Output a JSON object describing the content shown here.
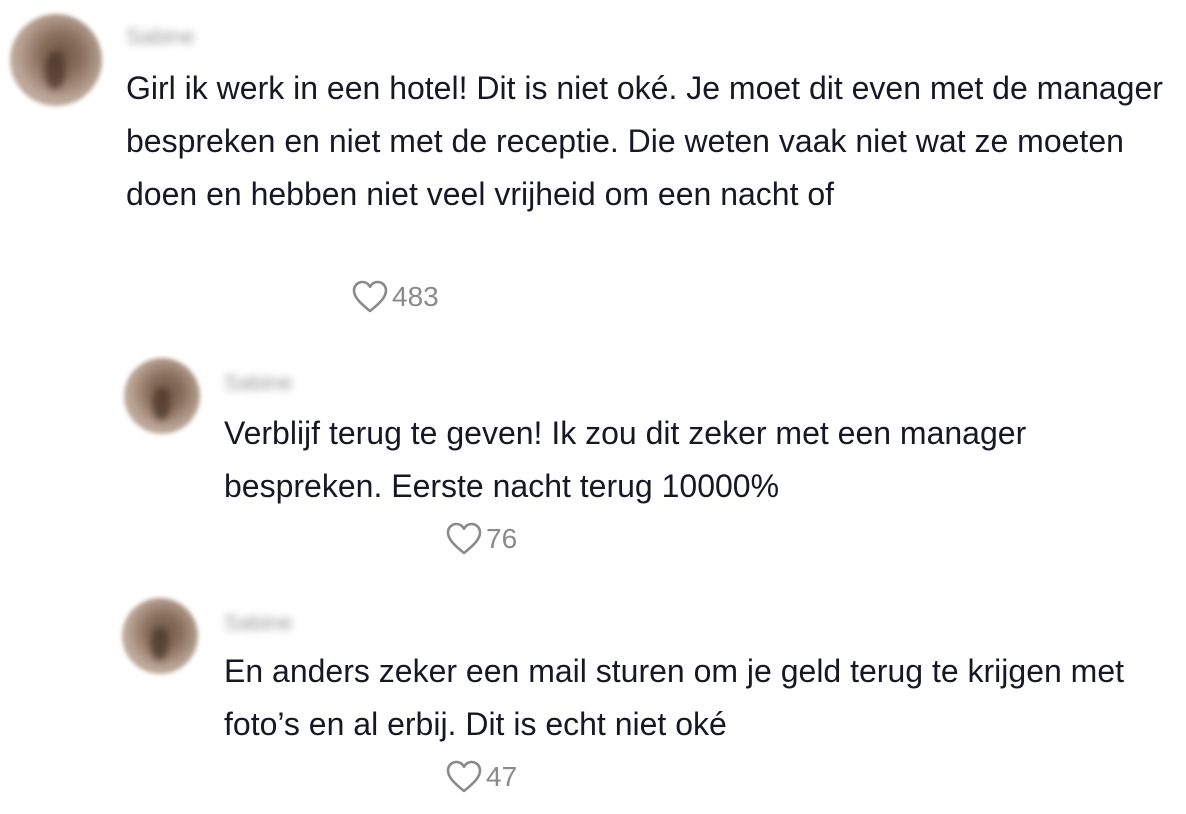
{
  "comments": [
    {
      "username": "Sabine",
      "text": "Girl ik werk in een hotel! Dit is niet oké. Je moet dit even met de manager bespreken en niet met de receptie. Die weten vaak niet wat ze moeten doen en hebben niet veel vrijheid om een nacht of",
      "likes": "483",
      "avatar_icon": "user-avatar",
      "like_icon": "heart-outline-icon"
    },
    {
      "username": "Sabine",
      "text": "Verblijf terug te geven! Ik zou dit zeker met een manager bespreken. Eerste nacht terug 10000%",
      "likes": "76",
      "avatar_icon": "user-avatar",
      "like_icon": "heart-outline-icon"
    },
    {
      "username": "Sabine",
      "text": "En anders zeker een mail sturen om je geld terug te krijgen met foto’s en al erbij. Dit is echt niet oké",
      "likes": "47",
      "avatar_icon": "user-avatar",
      "like_icon": "heart-outline-icon"
    }
  ],
  "colors": {
    "text": "#161823",
    "muted": "#8a8a8a",
    "background": "#ffffff"
  }
}
